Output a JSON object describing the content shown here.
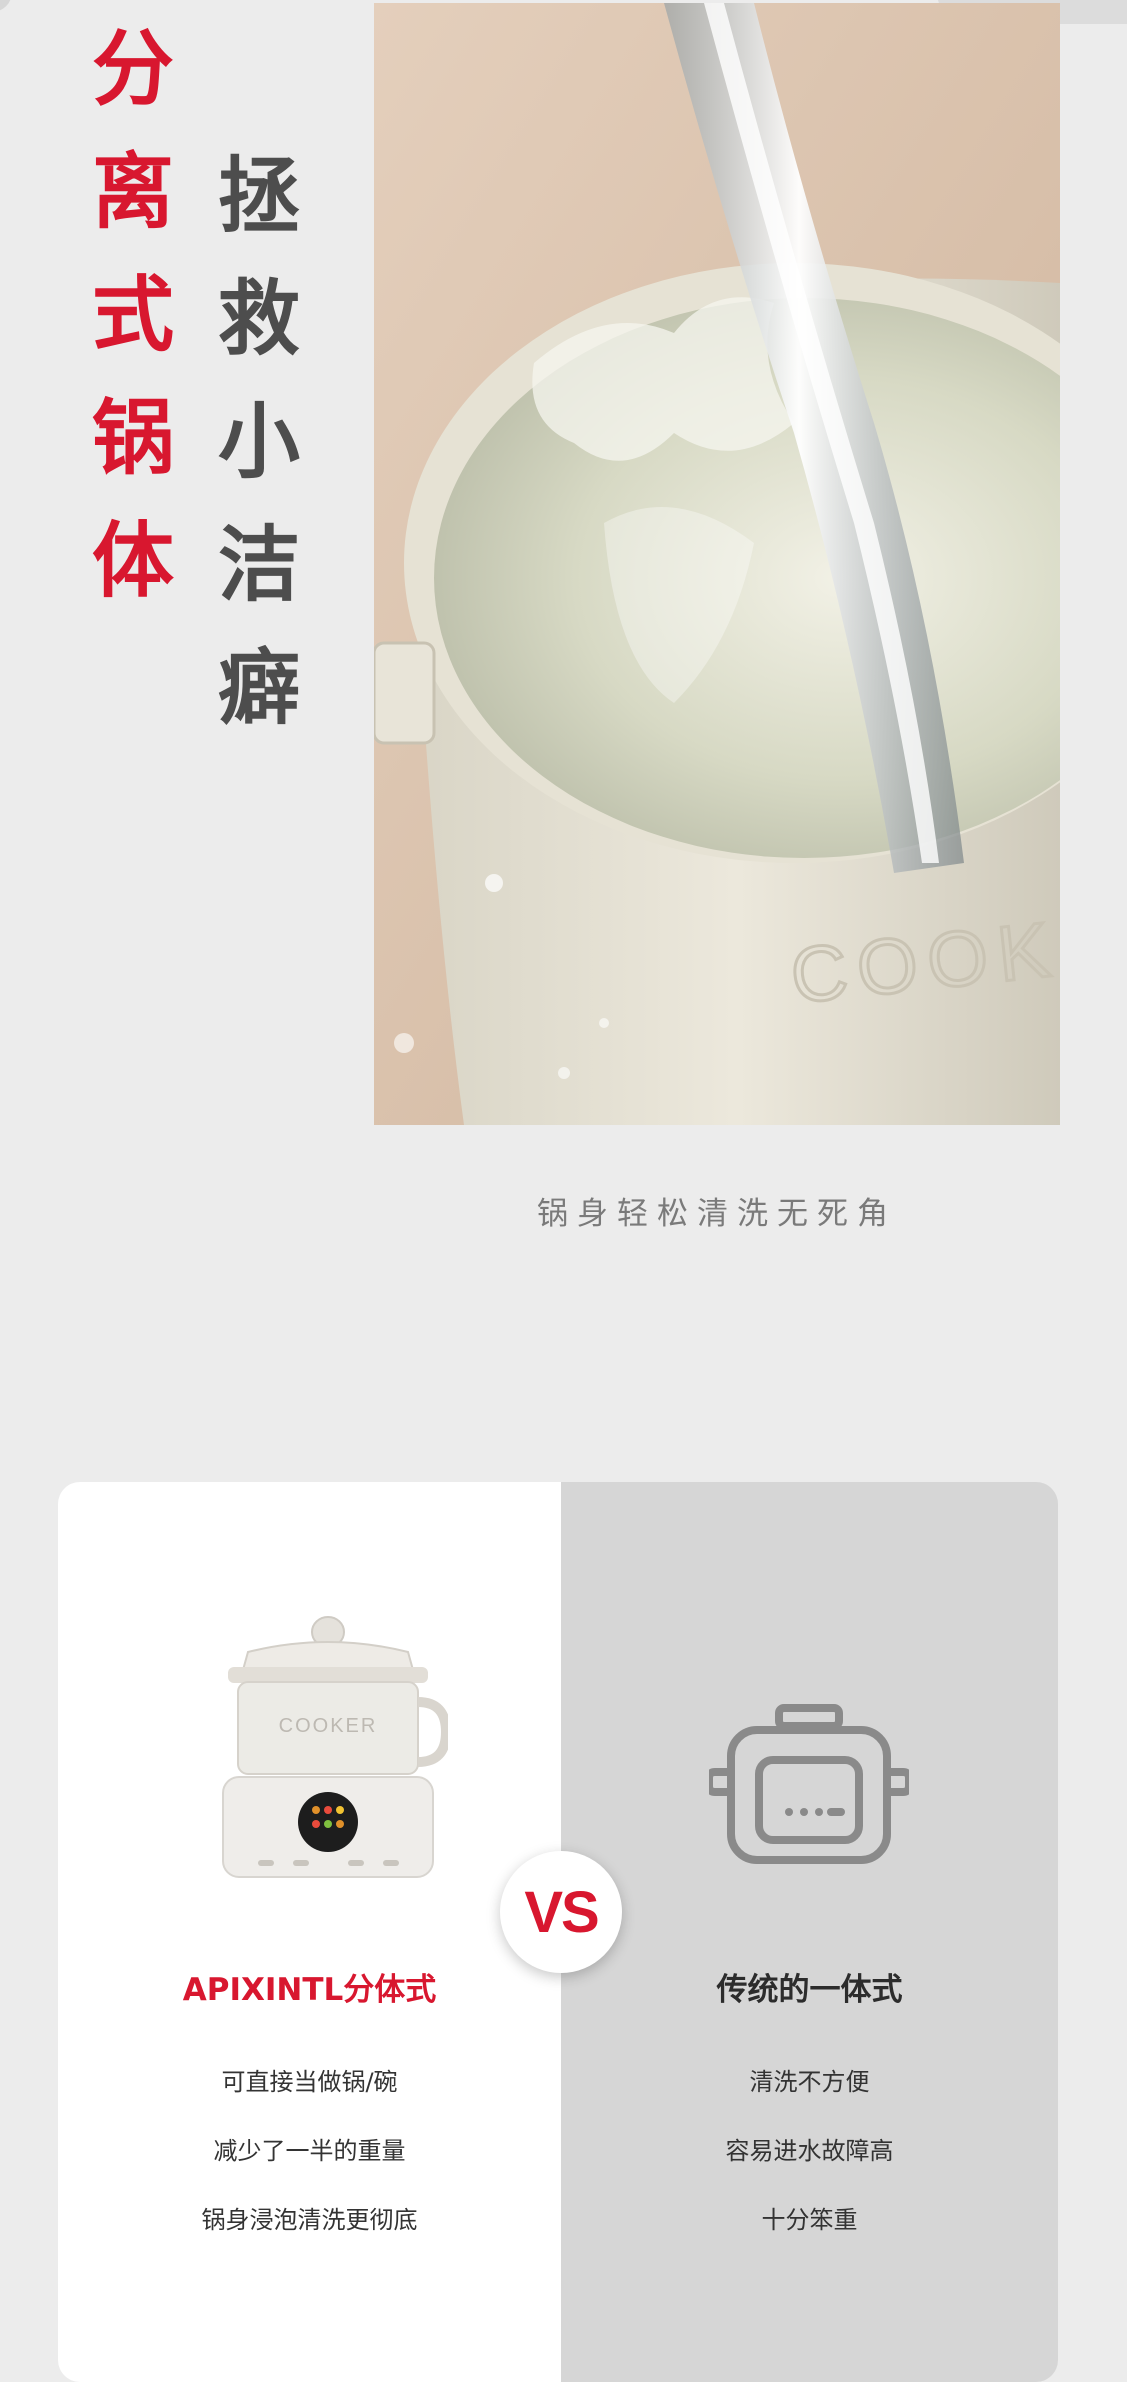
{
  "headline": {
    "red_chars": [
      "分",
      "离",
      "式",
      "锅",
      "体"
    ],
    "gray_chars": [
      "拯",
      "救",
      "小",
      "洁",
      "癖"
    ]
  },
  "photo": {
    "alt": "water poured into detachable pot",
    "embossed_brand": "COOKS"
  },
  "caption": "锅身轻松清洗无死角",
  "comparison": {
    "left": {
      "title": "APIXINTL分体式",
      "product_brand": "COOKER",
      "features": [
        "可直接当做锅/碗",
        "减少了一半的重量",
        "锅身浸泡清洗更彻底"
      ]
    },
    "right": {
      "title": "传统的一体式",
      "features": [
        "清洗不方便",
        "容易进水故障高",
        "十分笨重"
      ]
    },
    "vs_label": "VS"
  },
  "colors": {
    "accent_red": "#d8172f",
    "dark_text": "#4d4d4d",
    "background": "#ececec"
  }
}
